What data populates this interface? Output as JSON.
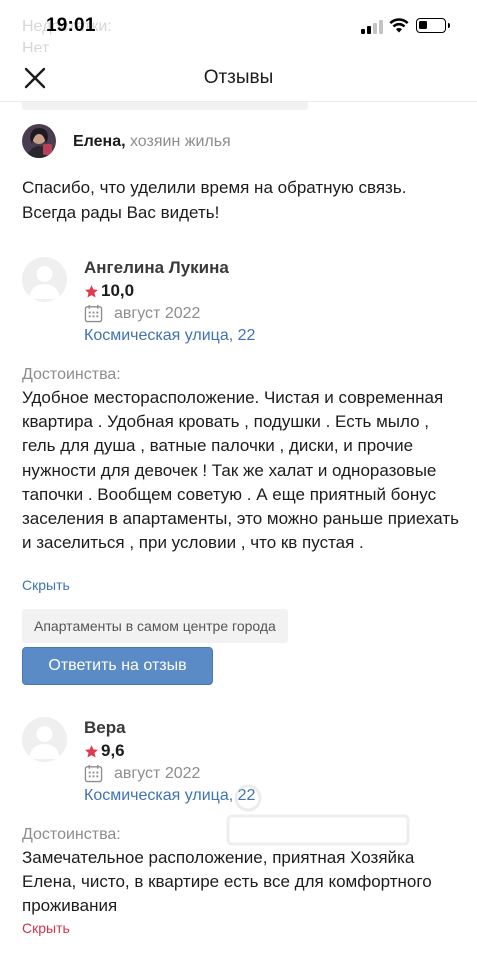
{
  "background_text": "Недостатки:\nНет",
  "status_bar": {
    "time": "19:01"
  },
  "nav": {
    "title": "Отзывы",
    "close_icon": "close-x-icon"
  },
  "owner_reply": {
    "name": "Елена,",
    "role": " хозяин жилья",
    "text": "Спасибо, что уделили время на обратную связь. Всегда рады Вас видеть!"
  },
  "reviews": [
    {
      "name": "Ангелина Лукина",
      "rating": "10,0",
      "date": "август 2022",
      "address": "Космическая улица, 22",
      "advantages_label": "Достоинства:",
      "text": "Удобное месторасположение. Чистая и современная квартира . Удобная кровать , подушки . Есть мыло , гель для душа , ватные палочки , диски, и прочие нужности для девочек ! Так же халат и одноразовые тапочки . Вообщем советую . А еще приятный бонус заселения в апартаменты, это можно раньше приехать и заселиться , при условии , что кв пустая .",
      "hide_label": "Скрыть",
      "hide_color": "#3f73b3",
      "tag": "Апартаменты в самом центре города",
      "reply_label": "Ответить на отзыв"
    },
    {
      "name": "Вера",
      "rating": "9,6",
      "date": "август 2022",
      "address": "Космическая улица, 22",
      "advantages_label": "Достоинства:",
      "text": "Замечательное расположение, приятная Хозяйка Елена, чисто, в квартире есть все для комфортного проживания",
      "hide_label": "Скрыть",
      "hide_color": "#d0354a"
    }
  ],
  "colors": {
    "accent_blue": "#5b8bc7",
    "link_blue": "#3f73b3",
    "star_red": "#e03a4f"
  }
}
